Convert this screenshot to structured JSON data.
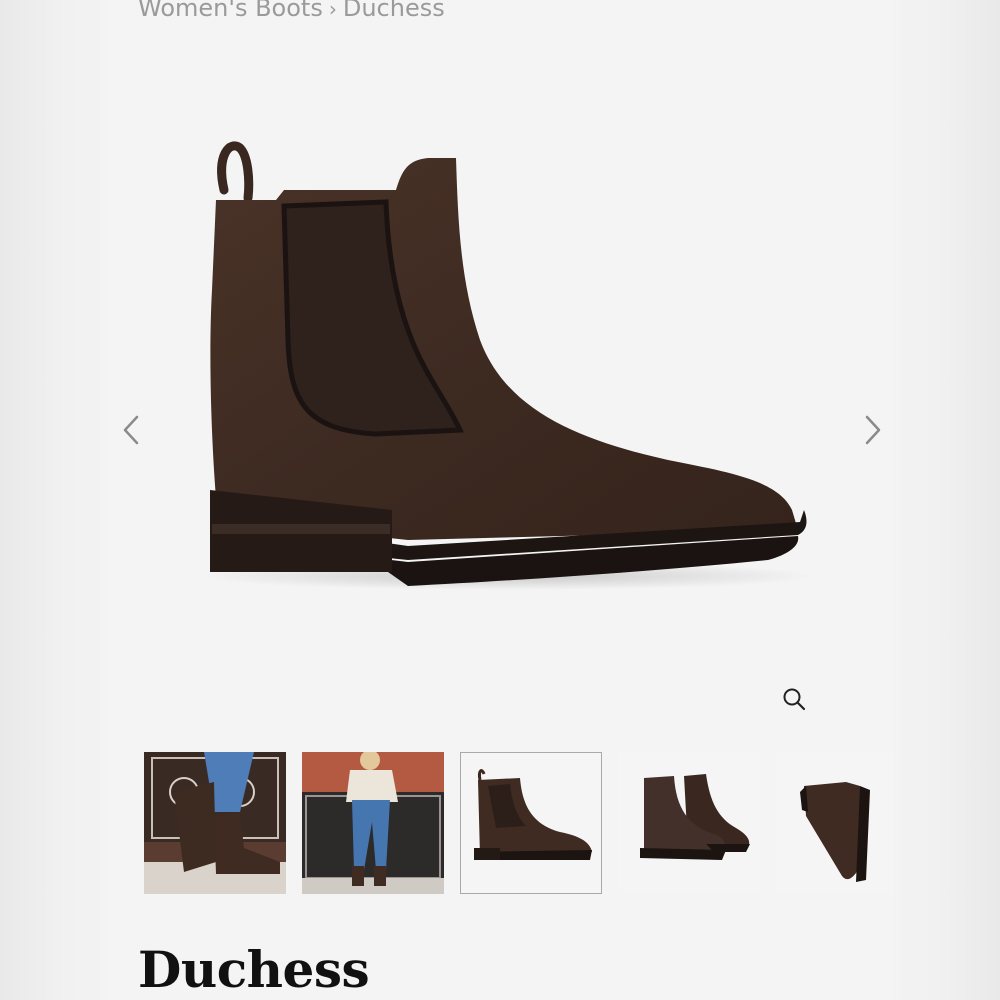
{
  "breadcrumb": {
    "parent": "Women's Boots",
    "separator": "›",
    "current": "Duchess"
  },
  "gallery": {
    "main_image": "chelsea-boot-side-view",
    "thumbnails": [
      {
        "name": "lifestyle-closeup",
        "selected": false
      },
      {
        "name": "lifestyle-full",
        "selected": false
      },
      {
        "name": "side-view",
        "selected": true
      },
      {
        "name": "pair-view",
        "selected": false
      },
      {
        "name": "sole-view",
        "selected": false
      }
    ],
    "prev_icon": "chevron-left-icon",
    "next_icon": "chevron-right-icon",
    "zoom_icon": "magnifier-icon"
  },
  "product": {
    "title": "Duchess"
  },
  "colors": {
    "boot": "#3f2b22",
    "sole": "#1e1614",
    "page_bg": "#f4f4f4"
  }
}
